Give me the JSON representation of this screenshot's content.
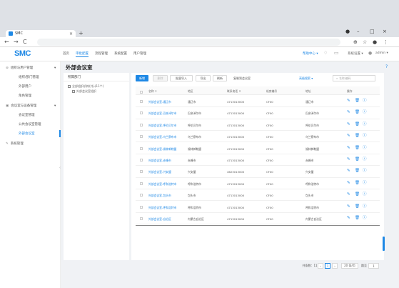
{
  "browser": {
    "tab_title": "SMC",
    "tab_close": "×",
    "new_tab": "+",
    "back": "←",
    "forward": "→",
    "reload": "C",
    "win_min": "–",
    "win_max": "□",
    "win_close": "×"
  },
  "app": {
    "logo": "SMC",
    "nav": [
      "首页",
      "审批配置",
      "流程管理",
      "系统配置",
      "用户管理"
    ],
    "active_nav_index": 1,
    "right": {
      "link1": "帮助中心 ▾",
      "link2": "系统设置 ▾",
      "user": "admin ▾"
    }
  },
  "sidebar": {
    "groups": [
      {
        "label": "组织与用户管理",
        "caret": "▾",
        "items": [
          "组织/部门管理",
          "外部用户",
          "角色管理"
        ]
      },
      {
        "label": "会议室与设备管理",
        "caret": "▾",
        "items": [
          "会议室管理",
          "公共会议室管理",
          "外部会议室"
        ]
      },
      {
        "label": "系统管理",
        "caret": "",
        "items": []
      }
    ],
    "selected_item": "外部会议室"
  },
  "page": {
    "title": "外部会议室",
    "help": "?",
    "tree": {
      "title": "所属部门",
      "nodes": [
        "全部组织机构(共计11个)",
        "外部会议室组织"
      ]
    },
    "toolbar": {
      "buttons": [
        "新增",
        "删除",
        "批量导入",
        "导出",
        "刷新",
        "复制到会议室"
      ],
      "filter": "高级搜索 ▾",
      "search_placeholder": "名称/编码"
    },
    "table": {
      "columns": [
        "名称 ↕",
        "地区",
        "联系电话 ↕",
        "机房编号",
        "地址",
        "操作"
      ],
      "rows": [
        [
          "外部会议室-通辽市",
          "通辽市",
          "4713013000",
          "CF00",
          "通辽市"
        ],
        [
          "外部会议室-巴彦淖尔市",
          "巴彦淖尔市",
          "4713013000",
          "CF00",
          "巴彦淖尔市"
        ],
        [
          "外部会议室-呼伦贝尔市",
          "呼伦贝尔市",
          "4713013000",
          "CF00",
          "呼伦贝尔市"
        ],
        [
          "外部会议室-乌兰察布市",
          "乌兰察布市",
          "4713013000",
          "CF00",
          "乌兰察布市"
        ],
        [
          "外部会议室-锡林郭勒盟",
          "锡林郭勒盟",
          "4713013000",
          "CF00",
          "锡林郭勒盟"
        ],
        [
          "外部会议室-赤峰市",
          "赤峰市",
          "4713013000",
          "CF00",
          "赤峰市"
        ],
        [
          "外部会议室-兴安盟",
          "兴安盟",
          "4623013000",
          "CF00",
          "兴安盟"
        ],
        [
          "外部会议室-呼和浩特市",
          "呼和浩特市",
          "4713013000",
          "CF00",
          "呼和浩特市"
        ],
        [
          "外部会议室-包头市",
          "包头市",
          "4713013000",
          "CF00",
          "包头市"
        ],
        [
          "外部会议室-呼和浩特市",
          "呼和浩特市",
          "4713013000",
          "CF00",
          "呼和浩特市"
        ],
        [
          "外部会议室-自治区",
          "内蒙古自治区",
          "4713013000",
          "CF00",
          "内蒙古自治区"
        ]
      ],
      "row_actions": [
        "edit-icon",
        "delete-icon",
        "info-icon"
      ]
    },
    "pagination": {
      "total": "共条数：11",
      "prev": "‹",
      "current": "1",
      "next": "›",
      "page_size": "20 条/页",
      "goto_label": "跳至",
      "goto_value": "1"
    }
  },
  "colors": {
    "accent": "#1e88e5",
    "content_bg": "#f0f2f5"
  }
}
